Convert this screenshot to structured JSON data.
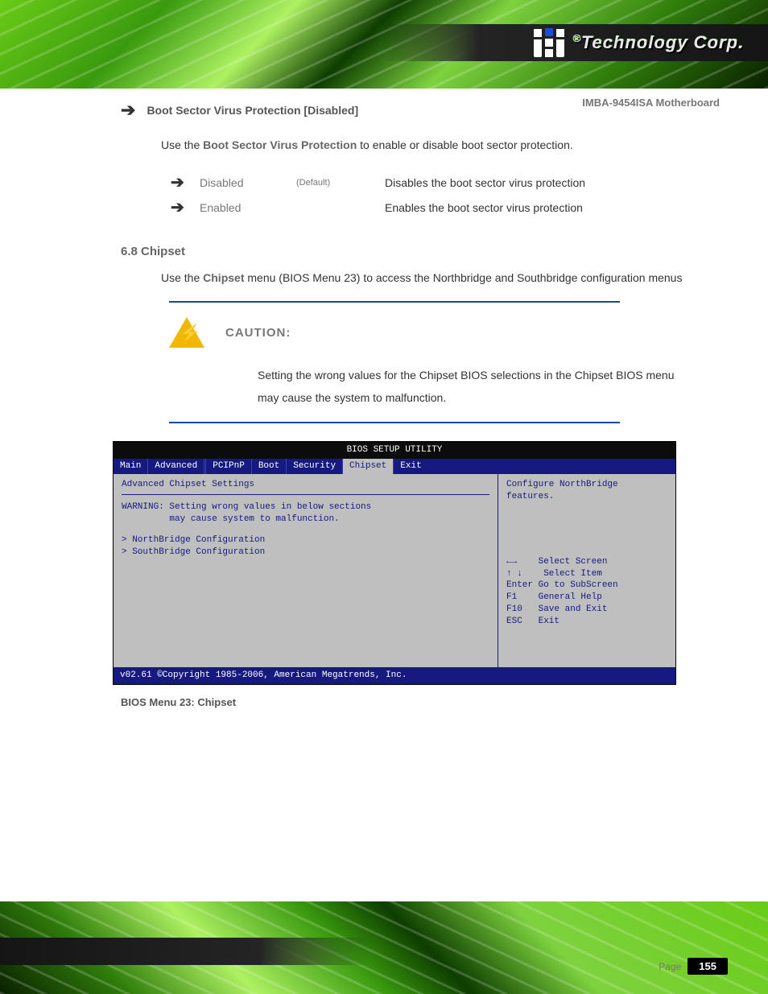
{
  "brand": {
    "reg": "®",
    "text": "Technology Corp."
  },
  "doc_title": "IMBA-9454ISA Motherboard",
  "section": {
    "item_label": "Boot Sector Virus Protection [Disabled]",
    "intro_pre": "Use the ",
    "intro_bold": "Boot Sector Virus Protection",
    "intro_post": " to enable or disable boot sector protection.",
    "options": [
      {
        "name": "Disabled",
        "def": "(Default)",
        "desc": "Disables the boot sector virus protection"
      },
      {
        "name": "Enabled",
        "def": "",
        "desc": "Enables the boot sector virus protection"
      }
    ]
  },
  "chipset": {
    "heading": "6.8 Chipset",
    "para_pre": "Use  the  ",
    "para_bold": "Chipset",
    "para_post": "  menu  (BIOS Menu 23)  to  access  the  Northbridge  and  Southbridge configuration menus",
    "caution_label": "CAUTION:",
    "caution_text": "Setting the wrong values for the Chipset BIOS selections in the Chipset BIOS menu may cause the system to malfunction."
  },
  "bios": {
    "title": "BIOS SETUP UTILITY",
    "tabs": [
      "Main",
      "Advanced",
      "PCIPnP",
      "Boot",
      "Security",
      "Chipset",
      "Exit"
    ],
    "selected_tab": "Chipset",
    "left_heading": "Advanced Chipset Settings",
    "left_warning": "WARNING: Setting wrong values in below sections\n         may cause system to malfunction.",
    "items": [
      "> NorthBridge Configuration",
      "> SouthBridge Configuration"
    ],
    "hint": "Configure NorthBridge\nfeatures.",
    "help": [
      "←→    Select Screen",
      "↑ ↓    Select Item",
      "Enter Go to SubScreen",
      "F1    General Help",
      "F10   Save and Exit",
      "ESC   Exit"
    ],
    "footer": "v02.61 ©Copyright 1985-2006, American Megatrends, Inc."
  },
  "figure_caption_label": "BIOS Menu 23: Chipset",
  "page": {
    "label": "Page",
    "num": "155"
  }
}
